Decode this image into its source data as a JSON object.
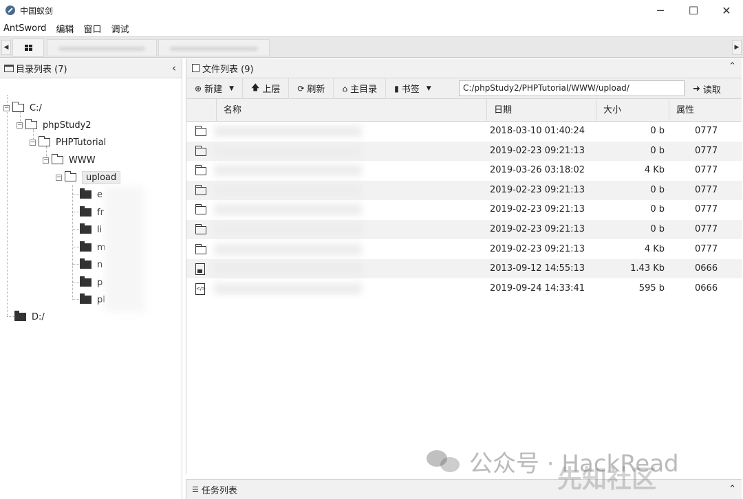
{
  "window": {
    "title": "中国蚁剑",
    "minimize": "─",
    "maximize": "☐",
    "close": "✕"
  },
  "menu": [
    "AntSword",
    "编辑",
    "窗口",
    "调试"
  ],
  "left_panel": {
    "title": "目录列表 (7)",
    "collapse_glyph": "‹",
    "tree": {
      "root_c": "C:/",
      "phpstudy": "phpStudy2",
      "phptutorial": "PHPTutorial",
      "www": "WWW",
      "upload": "upload",
      "children": [
        "e",
        "fr",
        "li",
        "m",
        "n",
        "p",
        "pl"
      ],
      "root_d": "D:/"
    }
  },
  "right_panel": {
    "title": "文件列表 (9)",
    "toolbar": {
      "new": "新建",
      "up": "上层",
      "refresh": "刷新",
      "home": "主目录",
      "bookmark": "书签",
      "path": "C:/phpStudy2/PHPTutorial/WWW/upload/",
      "read": "读取"
    },
    "columns": {
      "name": "名称",
      "date": "日期",
      "size": "大小",
      "attr": "属性"
    },
    "rows": [
      {
        "icon": "folder-icon",
        "date": "2018-03-10 01:40:24",
        "size": "0 b",
        "attr": "0777"
      },
      {
        "icon": "folder-icon",
        "date": "2019-02-23 09:21:13",
        "size": "0 b",
        "attr": "0777"
      },
      {
        "icon": "folder-icon",
        "date": "2019-03-26 03:18:02",
        "size": "4 Kb",
        "attr": "0777"
      },
      {
        "icon": "folder-icon",
        "date": "2019-02-23 09:21:13",
        "size": "0 b",
        "attr": "0777"
      },
      {
        "icon": "folder-icon",
        "date": "2019-02-23 09:21:13",
        "size": "0 b",
        "attr": "0777"
      },
      {
        "icon": "folder-icon",
        "date": "2019-02-23 09:21:13",
        "size": "0 b",
        "attr": "0777"
      },
      {
        "icon": "folder-icon",
        "date": "2019-02-23 09:21:13",
        "size": "4 Kb",
        "attr": "0777"
      },
      {
        "icon": "image-file-icon",
        "date": "2013-09-12 14:55:13",
        "size": "1.43 Kb",
        "attr": "0666"
      },
      {
        "icon": "code-file-icon",
        "date": "2019-09-24 14:33:41",
        "size": "595 b",
        "attr": "0666"
      }
    ]
  },
  "task_panel": {
    "title": "任务列表"
  },
  "watermark": {
    "text": "公众号 · HackRead",
    "brand": "先知社区"
  }
}
